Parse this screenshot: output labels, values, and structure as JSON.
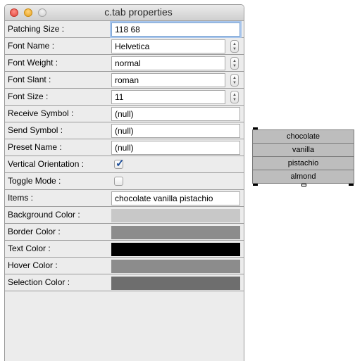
{
  "window": {
    "title": "c.tab properties"
  },
  "properties": {
    "patching_size": {
      "label": "Patching Size :",
      "value": "118 68"
    },
    "font_name": {
      "label": "Font Name :",
      "value": "Helvetica"
    },
    "font_weight": {
      "label": "Font Weight :",
      "value": "normal"
    },
    "font_slant": {
      "label": "Font Slant :",
      "value": "roman"
    },
    "font_size": {
      "label": "Font Size :",
      "value": "11"
    },
    "receive_symbol": {
      "label": "Receive Symbol :",
      "value": "(null)"
    },
    "send_symbol": {
      "label": "Send Symbol :",
      "value": "(null)"
    },
    "preset_name": {
      "label": "Preset Name :",
      "value": "(null)"
    },
    "vertical_orientation": {
      "label": "Vertical Orientation :",
      "checked": true
    },
    "toggle_mode": {
      "label": "Toggle Mode :",
      "checked": false
    },
    "items": {
      "label": "Items :",
      "value": "chocolate vanilla pistachio"
    },
    "background_color": {
      "label": "Background Color :",
      "color": "#c8c8c8"
    },
    "border_color": {
      "label": "Border Color :",
      "color": "#8c8c8c"
    },
    "text_color": {
      "label": "Text Color :",
      "color": "#000000"
    },
    "hover_color": {
      "label": "Hover Color :",
      "color": "#8c8c8c"
    },
    "selection_color": {
      "label": "Selection Color :",
      "color": "#6e6e6e"
    }
  },
  "tab_object": {
    "items": [
      "chocolate",
      "vanilla",
      "pistachio",
      "almond"
    ]
  }
}
